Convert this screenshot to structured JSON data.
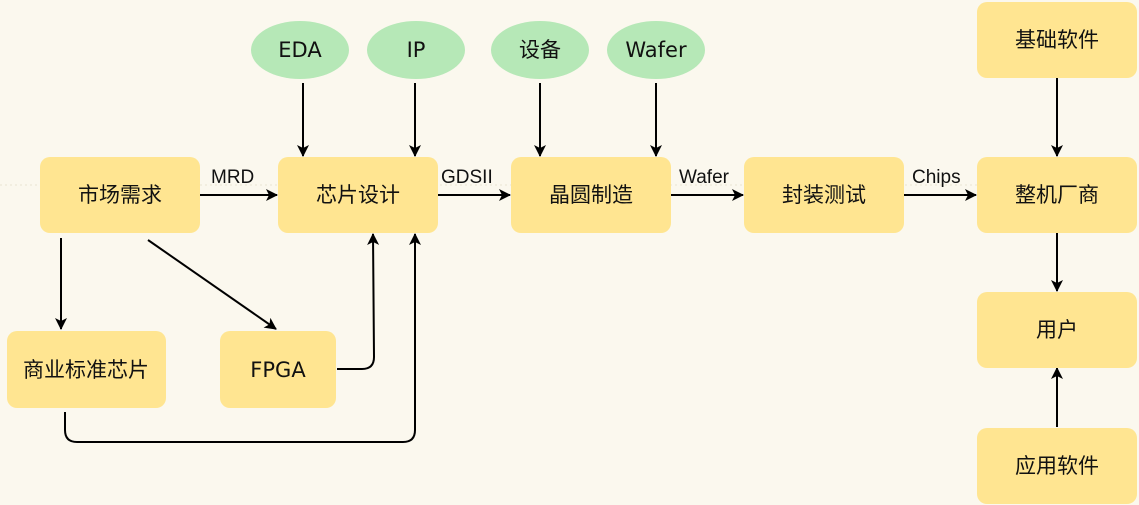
{
  "diagram": {
    "colors": {
      "process_node": "#ffe591",
      "input_node": "#b6e8b7",
      "edge": "#000000",
      "background": "#fbf8ee"
    },
    "nodes": {
      "market_demand": "市场需求",
      "chip_design": "芯片设计",
      "wafer_fab": "晶圆制造",
      "packaging_test": "封装测试",
      "oem": "整机厂商",
      "base_software": "基础软件",
      "user": "用户",
      "app_software": "应用软件",
      "commercial_chip": "商业标准芯片",
      "fpga": "FPGA",
      "eda": "EDA",
      "ip": "IP",
      "equipment": "设备",
      "wafer_input": "Wafer"
    },
    "edge_labels": {
      "mrd": "MRD",
      "gdsii": "GDSII",
      "wafer": "Wafer",
      "chips": "Chips"
    }
  }
}
